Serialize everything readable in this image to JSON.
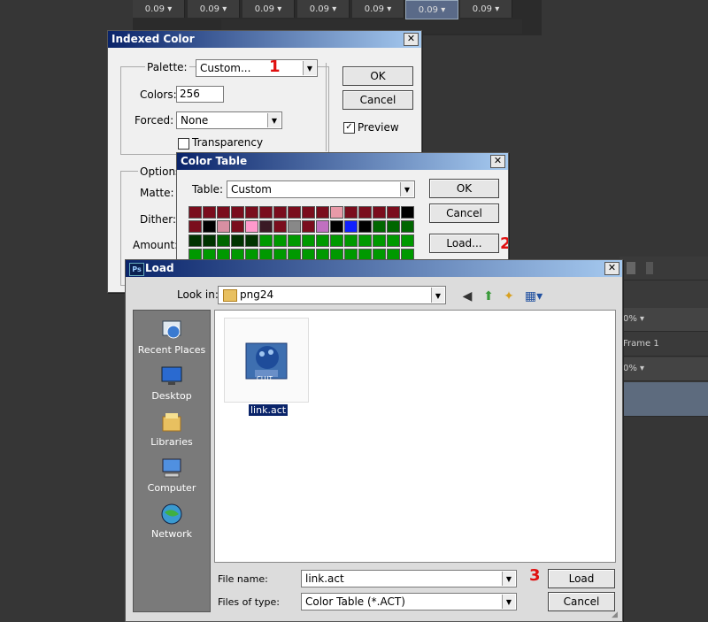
{
  "background": {
    "frame_delays": [
      "0.09 ▾",
      "0.09 ▾",
      "0.09 ▾",
      "0.09 ▾",
      "0.09 ▾",
      "0.09 ▾",
      "0.09 ▾"
    ],
    "right_panel": {
      "row1": "0% ▾",
      "row2": "Frame 1",
      "row3": "0% ▾"
    }
  },
  "indexed_color": {
    "title": "Indexed Color",
    "palette_label": "Palette:",
    "palette_value": "Custom...",
    "colors_label": "Colors:",
    "colors_value": "256",
    "forced_label": "Forced:",
    "forced_value": "None",
    "transparency_label": "Transparency",
    "options_label": "Options",
    "matte_label": "Matte:",
    "dither_label": "Dither:",
    "amount_label": "Amount:",
    "ok_label": "OK",
    "cancel_label": "Cancel",
    "preview_label": "Preview",
    "preview_checked": true
  },
  "color_table": {
    "title": "Color Table",
    "table_label": "Table:",
    "table_value": "Custom",
    "ok_label": "OK",
    "cancel_label": "Cancel",
    "load_label": "Load...",
    "swatches": [
      [
        "#7a0d1d",
        "#7a0d1d",
        "#7a0d1d",
        "#7a0d1d",
        "#7a0d1d",
        "#7a0d1d",
        "#7a0d1d",
        "#7a0d1d",
        "#7a0d1d",
        "#7a0d1d",
        "#e89aa8",
        "#7a0d1d",
        "#7a0d1d",
        "#7a0d1d",
        "#7a0d1d",
        "#000000"
      ],
      [
        "#7a0d1d",
        "#000000",
        "#d78fa2",
        "#7a0d1d",
        "#ff99cc",
        "#3a1a24",
        "#7a0d1d",
        "#888888",
        "#7a0d1d",
        "#c070c0",
        "#000000",
        "#1020ff",
        "#000000",
        "#006600",
        "#006600",
        "#006600"
      ],
      [
        "#003300",
        "#003300",
        "#006600",
        "#003300",
        "#003300",
        "#009900",
        "#009900",
        "#009900",
        "#009900",
        "#009900",
        "#009900",
        "#009900",
        "#009900",
        "#009900",
        "#009900",
        "#009900"
      ],
      [
        "#009900",
        "#009900",
        "#009900",
        "#009900",
        "#009900",
        "#009900",
        "#009900",
        "#009900",
        "#009900",
        "#009900",
        "#009900",
        "#009900",
        "#009900",
        "#009900",
        "#009900",
        "#009900"
      ]
    ]
  },
  "load_dialog": {
    "title": "Load",
    "ps_badge": "Ps",
    "look_in_label": "Look in:",
    "look_in_value": "png24",
    "places": [
      "Recent Places",
      "Desktop",
      "Libraries",
      "Computer",
      "Network"
    ],
    "file_name_item": "link.act",
    "file_icon_text": "CLUT",
    "file_name_label": "File name:",
    "file_name_value": "link.act",
    "files_of_type_label": "Files of type:",
    "files_of_type_value": "Color Table (*.ACT)",
    "load_label": "Load",
    "cancel_label": "Cancel"
  },
  "annotations": {
    "step1": "1",
    "step2": "2",
    "step3": "3"
  }
}
